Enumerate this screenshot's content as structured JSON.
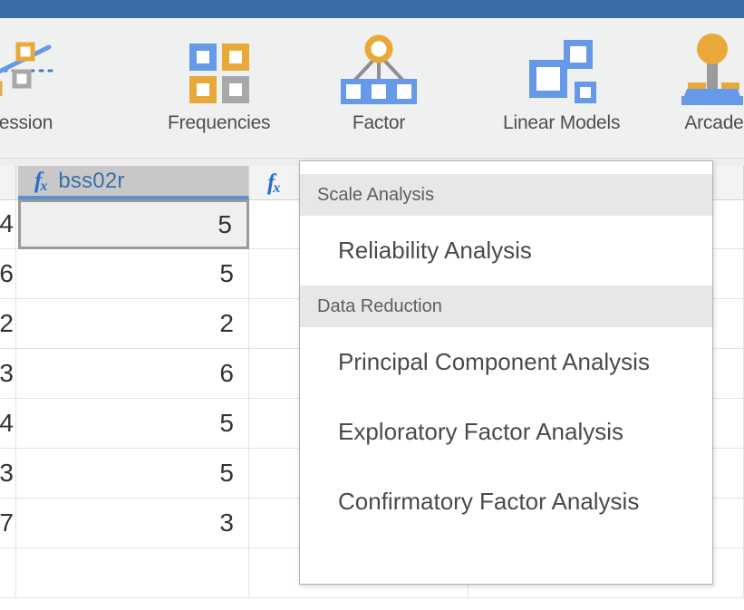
{
  "window": {
    "titlebar_color": "#3c6ca7",
    "ribbon_bg": "#eff0f0"
  },
  "ribbon": {
    "groups": [
      {
        "icon": "regression-scatter-icon",
        "label": "Regression"
      },
      {
        "icon": "frequencies-grid-icon",
        "label": "Frequencies"
      },
      {
        "icon": "factor-tree-icon",
        "label": "Factor"
      },
      {
        "icon": "linear-models-squares-icon",
        "label": "Linear Models"
      },
      {
        "icon": "arcade-joystick-icon",
        "label": "Arcade"
      }
    ]
  },
  "spreadsheet": {
    "columns": [
      {
        "name": "",
        "fx": "fx",
        "selected": false
      },
      {
        "name": "bss02r",
        "fx": "fx",
        "selected": true
      },
      {
        "name": "",
        "fx": "fx",
        "selected": false
      },
      {
        "name": "",
        "fx": "",
        "selected": false
      }
    ],
    "rows": [
      {
        "prev": "4",
        "value": "5",
        "selected": true
      },
      {
        "prev": "6",
        "value": "5",
        "selected": false
      },
      {
        "prev": "2",
        "value": "2",
        "selected": false
      },
      {
        "prev": "3",
        "value": "6",
        "selected": false
      },
      {
        "prev": "4",
        "value": "5",
        "selected": false
      },
      {
        "prev": "3",
        "value": "5",
        "selected": false
      },
      {
        "prev": "7",
        "value": "3",
        "selected": false
      },
      {
        "prev": "",
        "value": "",
        "selected": false
      }
    ]
  },
  "menu": {
    "sections": [
      {
        "header": "Scale Analysis",
        "items": [
          "Reliability Analysis"
        ]
      },
      {
        "header": "Data Reduction",
        "items": [
          "Principal Component Analysis",
          "Exploratory Factor Analysis",
          "Confirmatory Factor Analysis"
        ]
      }
    ]
  },
  "colors": {
    "accent_blue": "#6699e8",
    "accent_orange": "#e8a93a",
    "accent_gray": "#a8a8a8",
    "title_blue": "#3c6ca7",
    "link_blue": "#2570c8"
  }
}
